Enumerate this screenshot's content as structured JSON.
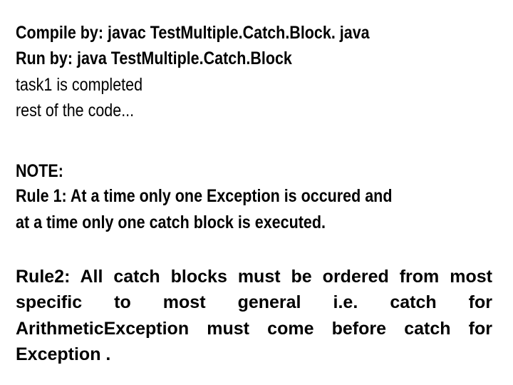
{
  "document": {
    "compile_line": "Compile by: javac TestMultiple.Catch.Block. java",
    "run_line": "Run by: java TestMultiple.Catch.Block",
    "output_lines": [
      "task1 is completed",
      "rest of the code..."
    ],
    "note_heading": "NOTE:",
    "rule1_lines": [
      "Rule 1: At a time only one Exception is occured and",
      "at a time only one catch block is executed."
    ],
    "rule2_lines": [
      "Rule2: All catch blocks must be ordered from most",
      "specific to most general i.e. catch for",
      "ArithmeticException must come before catch for",
      "Exception ."
    ]
  }
}
